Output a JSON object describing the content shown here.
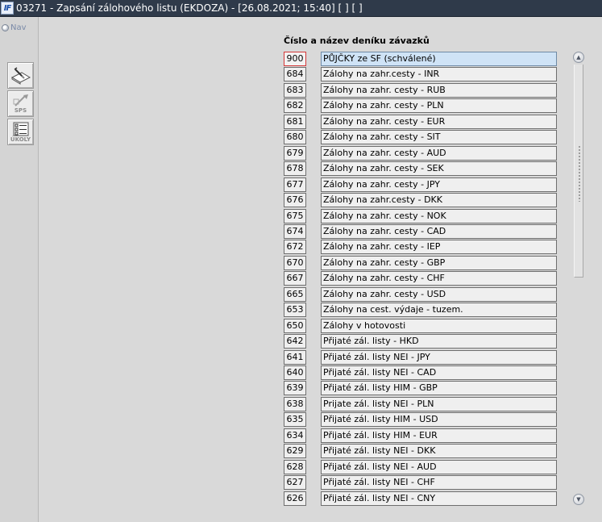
{
  "window": {
    "logo_text": "IF",
    "title": "03271 - Zapsání zálohového listu (EKDOZA) - [26.08.2021; 15:40]  [ ]  [ ]"
  },
  "nav": {
    "label": "Nav",
    "tools": [
      {
        "icon": "edit-document-icon",
        "label": ""
      },
      {
        "icon": "sps-icon",
        "label": "SPS"
      },
      {
        "icon": "ukoly-icon",
        "label": "ÚKOLY"
      }
    ]
  },
  "list": {
    "header": "Číslo a název deníku závazků",
    "selected_index": 0,
    "rows": [
      {
        "num": "900",
        "name": "PŮJČKY ze SF (schválené)"
      },
      {
        "num": "684",
        "name": "Zálohy na zahr.cesty - INR"
      },
      {
        "num": "683",
        "name": "Zálohy na zahr. cesty - RUB"
      },
      {
        "num": "682",
        "name": "Zálohy na zahr. cesty - PLN"
      },
      {
        "num": "681",
        "name": "Zálohy na zahr. cesty - EUR"
      },
      {
        "num": "680",
        "name": "Zálohy na zahr. cesty - SIT"
      },
      {
        "num": "679",
        "name": "Zálohy na zahr. cesty - AUD"
      },
      {
        "num": "678",
        "name": "Zálohy na zahr. cesty - SEK"
      },
      {
        "num": "677",
        "name": "Zálohy na zahr. cesty - JPY"
      },
      {
        "num": "676",
        "name": "Zálohy na zahr.cesty - DKK"
      },
      {
        "num": "675",
        "name": "Zálohy na zahr. cesty - NOK"
      },
      {
        "num": "674",
        "name": "Zálohy na zahr. cesty - CAD"
      },
      {
        "num": "672",
        "name": "Zálohy na zahr. cesty - IEP"
      },
      {
        "num": "670",
        "name": "Zálohy na zahr. cesty - GBP"
      },
      {
        "num": "667",
        "name": "Zálohy na zahr. cesty - CHF"
      },
      {
        "num": "665",
        "name": "Zálohy na zahr. cesty - USD"
      },
      {
        "num": "653",
        "name": "Zálohy na cest. výdaje - tuzem."
      },
      {
        "num": "650",
        "name": "Zálohy v hotovosti"
      },
      {
        "num": "642",
        "name": "Přijaté zál. listy - HKD"
      },
      {
        "num": "641",
        "name": "Přijaté zál. listy NEI - JPY"
      },
      {
        "num": "640",
        "name": "Přijaté zál. listy NEI - CAD"
      },
      {
        "num": "639",
        "name": "Přijaté zál. listy HIM - GBP"
      },
      {
        "num": "638",
        "name": "Prijate zál. listy NEI - PLN"
      },
      {
        "num": "635",
        "name": "Přijaté zál. listy HIM - USD"
      },
      {
        "num": "634",
        "name": "Přijaté zál. listy HIM - EUR"
      },
      {
        "num": "629",
        "name": "Přijaté zál. listy NEI  - DKK"
      },
      {
        "num": "628",
        "name": "Přijaté zál. listy NEI - AUD"
      },
      {
        "num": "627",
        "name": "Přijaté zál. listy NEI - CHF"
      },
      {
        "num": "626",
        "name": "Přijaté zál. listy NEI  - CNY"
      }
    ]
  },
  "scrollbar": {
    "up_icon": "scroll-up-icon",
    "down_icon": "scroll-down-icon"
  },
  "colors": {
    "titlebar": "#2f3a4a",
    "selected_row": "#cfe3f6",
    "selected_border": "#d43838",
    "background": "#d9d9d9"
  }
}
